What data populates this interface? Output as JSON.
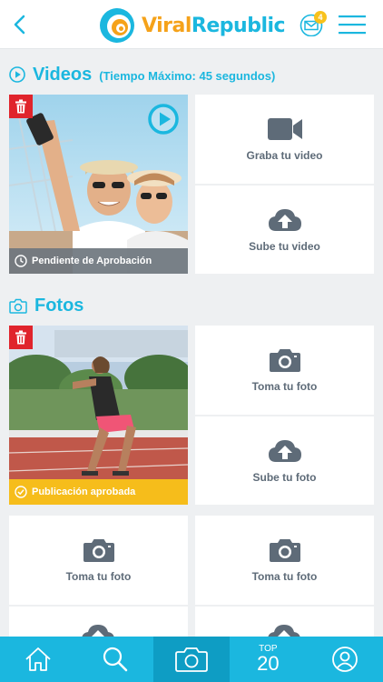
{
  "header": {
    "brand_part1": "Viral",
    "brand_part2": "Republic",
    "mail_badge": "4"
  },
  "videos": {
    "title": "Videos",
    "subtitle": "(Tiempo Máximo: 45 segundos)",
    "item_status": "Pendiente de Aprobación",
    "record_label": "Graba tu video",
    "upload_label": "Sube tu video"
  },
  "fotos": {
    "title": "Fotos",
    "item_status": "Publicación aprobada",
    "take_label": "Toma tu foto",
    "upload_label": "Sube tu foto",
    "grid_labels": [
      "Toma tu foto",
      "Toma tu foto"
    ]
  },
  "nav": {
    "top_label": "TOP",
    "top_number": "20"
  },
  "colors": {
    "accent": "#1bb7df",
    "brand_orange": "#f5a21a",
    "pending": "#707a84",
    "approved": "#f6bd1b",
    "delete": "#e0242c"
  },
  "icons": [
    "back-icon",
    "mail-icon",
    "menu-icon",
    "play-circle-icon",
    "camera-icon",
    "trash-icon",
    "clock-icon",
    "check-circle-icon",
    "video-camera-icon",
    "cloud-upload-icon",
    "home-icon",
    "search-icon",
    "user-icon"
  ]
}
